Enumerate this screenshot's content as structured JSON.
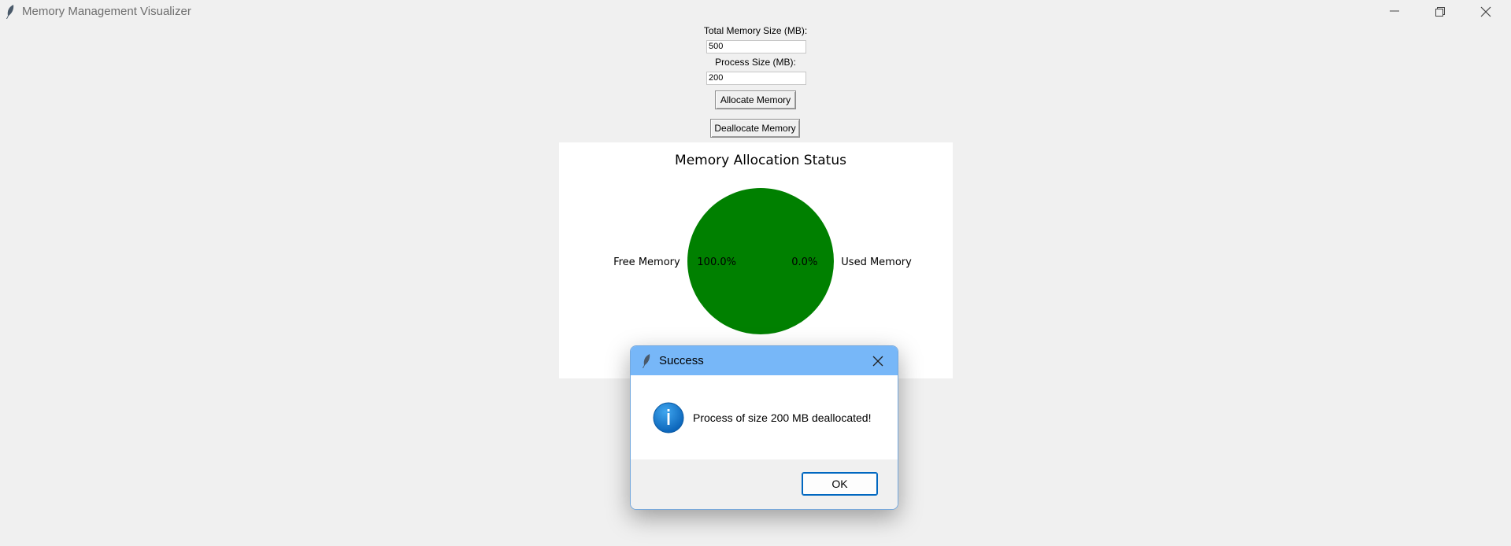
{
  "window": {
    "title": "Memory Management Visualizer",
    "icon": "feather-icon"
  },
  "form": {
    "total_label": "Total Memory Size (MB):",
    "total_value": "500",
    "process_label": "Process Size (MB):",
    "process_value": "200",
    "allocate_label": "Allocate Memory",
    "deallocate_label": "Deallocate Memory"
  },
  "chart_data": {
    "type": "pie",
    "title": "Memory Allocation Status",
    "slices": [
      {
        "label": "Free Memory",
        "value": 100.0,
        "pct_label": "100.0%",
        "color": "#008000"
      },
      {
        "label": "Used Memory",
        "value": 0.0,
        "pct_label": "0.0%",
        "color": "#ff0000"
      }
    ]
  },
  "dialog": {
    "title": "Success",
    "message": "Process of size 200 MB deallocated!",
    "ok_label": "OK",
    "header_color": "#77b7f8",
    "icon": "info-icon"
  }
}
